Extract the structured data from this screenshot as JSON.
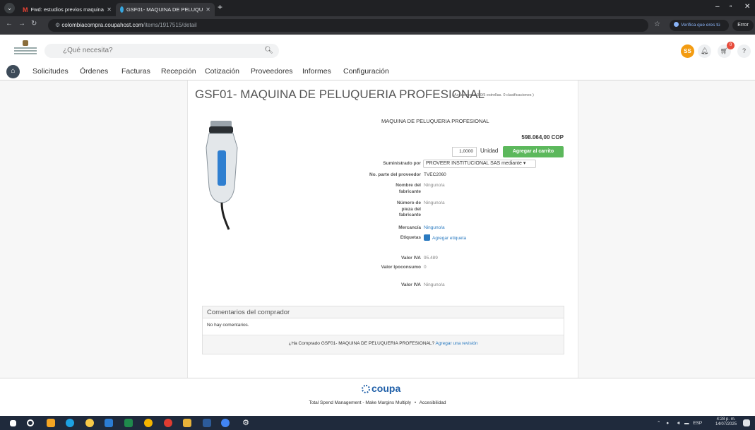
{
  "browser": {
    "tabs": [
      {
        "label": "Fwd: estudios previos maquina"
      },
      {
        "label": "GSF01- MAQUINA DE PELUQU"
      }
    ],
    "url_host": "colombiacompra.coupahost.com",
    "url_path": "/items/1917515/detail",
    "verify_label": "Verifica que eres tú",
    "error_label": "Error"
  },
  "header": {
    "search_placeholder": "¿Qué necesita?",
    "avatar_initials": "SS",
    "cart_count": "0"
  },
  "nav": {
    "items": [
      "Solicitudes",
      "Órdenes",
      "Facturas",
      "Recepción",
      "Cotización",
      "Proveedores",
      "Informes",
      "Configuración"
    ]
  },
  "product": {
    "title": "GSF01- MAQUINA DE PELUQUERIA PROFESIONAL",
    "rating": "( Actualmente 0.0/5 estrellas. 0 clasificaciones )",
    "description": "MAQUINA DE PELUQUERIA PROFESIONAL",
    "price": "598.064,00 COP",
    "quantity": "1,0000",
    "unit": "Unidad",
    "add_to_cart": "Agregar al carrito",
    "fields": {
      "supplied_by_label": "Suministrado por",
      "supplied_by_value": "PROVEER INSTITUCIONAL SAS mediante",
      "part_no_label": "No. parte del proveedor",
      "part_no_value": "TVEC2060",
      "manufacturer_label": "Nombre del fabricante",
      "manufacturer_value": "Ninguno/a",
      "mfr_part_label": "Número de pieza del fabricante",
      "mfr_part_value": "Ninguno/a",
      "commodity_label": "Mercancía",
      "commodity_value": "Ninguno/a",
      "tags_label": "Etiquetas",
      "tags_value": "Agregar etiqueta",
      "iva_label": "Valor IVA",
      "iva_value": "95.489",
      "ipoconsumo_label": "Valor Ipoconsumo",
      "ipoconsumo_value": "0",
      "iva2_label": "Valor IVA",
      "iva2_value": "Ninguno/a"
    }
  },
  "comments": {
    "heading": "Comentarios del comprador",
    "empty": "No hay comentarios.",
    "prompt": "¿Ha Comprado GSF01- MAQUINA DE PELUQUERIA PROFESIONAL?",
    "review_link": "Agregar una revisión"
  },
  "footer": {
    "brand": "coupa",
    "tagline": "Total Spend Management - Make Margins Multiply",
    "separator": "•",
    "accessibility": "Accesibilidad"
  },
  "taskbar": {
    "lang": "ESP",
    "time": "4:28 p. m.",
    "date": "14/07/2025"
  },
  "colors": {
    "accent_green": "#5cb85c",
    "link_blue": "#2a7ac0",
    "coupa_blue": "#1f5fa8"
  }
}
